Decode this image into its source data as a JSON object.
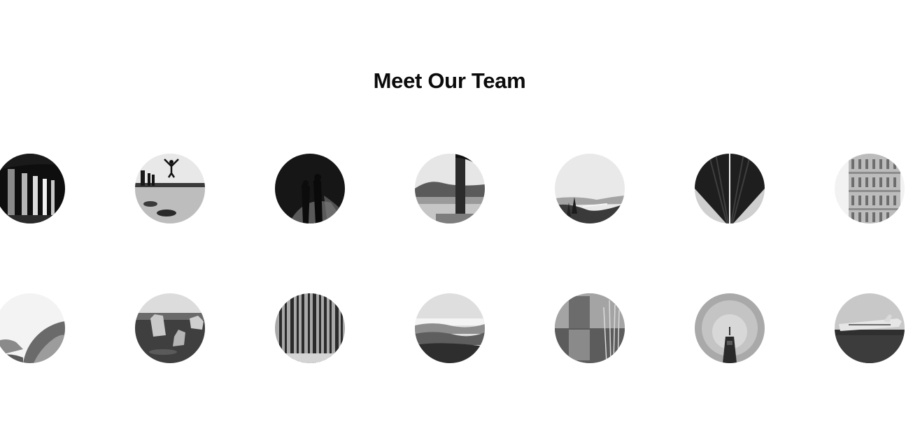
{
  "page": {
    "title": "Meet Our Team"
  },
  "team": {
    "rows": [
      [
        "arches-photo",
        "jumping-person-photo",
        "dark-couple-photo",
        "pier-mountains-photo",
        "valley-river-photo",
        "bridge-underside-photo",
        "leaning-tower-photo"
      ],
      [
        "misty-mountains-photo",
        "sea-stacks-photo",
        "forest-trees-photo",
        "rolling-hills-photo",
        "marsh-reflection-photo",
        "tower-fog-photo",
        "plane-wreck-photo"
      ]
    ]
  },
  "colors": {
    "background": "#ffffff",
    "title": "#0b0b0b"
  }
}
